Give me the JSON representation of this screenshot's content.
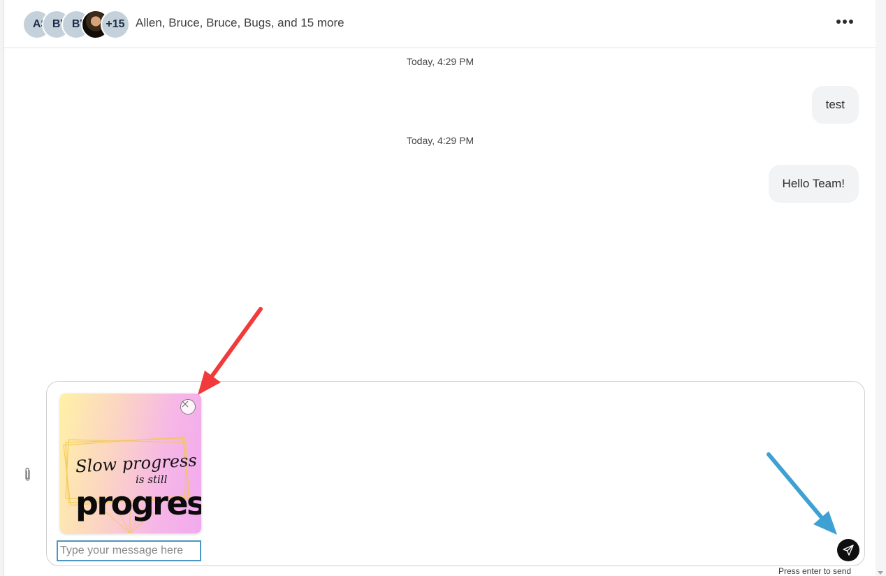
{
  "header": {
    "avatars": [
      {
        "initials": "AS"
      },
      {
        "initials": "BV"
      },
      {
        "initials": "BV"
      },
      {
        "initials": "",
        "type": "photo"
      },
      {
        "initials": "+15"
      }
    ],
    "participants": "Allen, Bruce, Bruce, Bugs, and 15 more",
    "more_icon": "more-horizontal-icon"
  },
  "messages": [
    {
      "time": "Today, 4:29 PM",
      "text": "test"
    },
    {
      "time": "Today, 4:29 PM",
      "text": "Hello Team!"
    }
  ],
  "composer": {
    "attachment": {
      "line1": "Slow progress",
      "line2": "is still",
      "line3": "progress",
      "colors": [
        "#fff1a6",
        "#f6b7e6"
      ]
    },
    "input_placeholder": "Type your message here",
    "input_value": "",
    "send_icon": "paper-plane-icon",
    "attach_icon": "paperclip-icon",
    "hint": "Press enter to send"
  },
  "annotations": {
    "red_arrow": "#f23a3a",
    "blue_arrow": "#3fa0d4"
  }
}
